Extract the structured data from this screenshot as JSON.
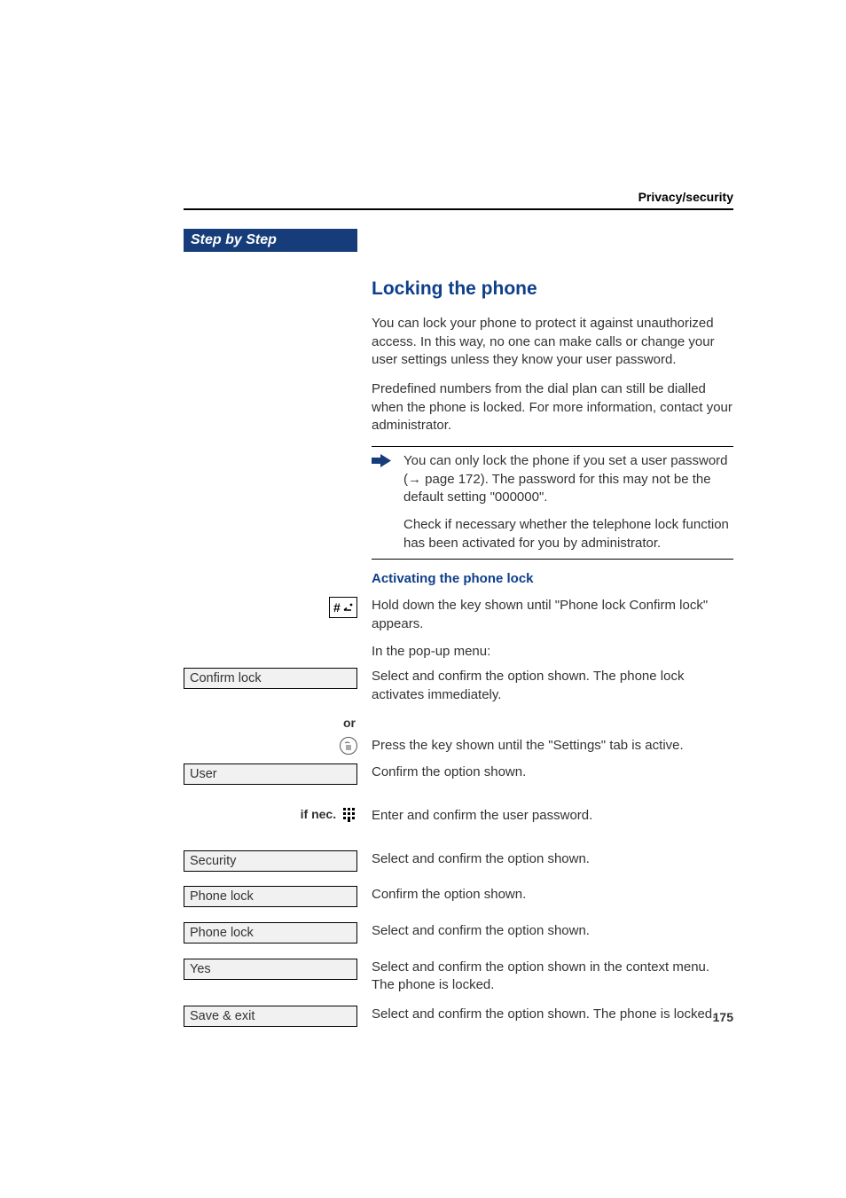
{
  "header": {
    "section": "Privacy/security"
  },
  "sidebar": {
    "step_header": "Step by Step",
    "confirm_lock": "Confirm lock",
    "or": "or",
    "user": "User",
    "if_nec": "if nec.",
    "security": "Security",
    "phone_lock_1": "Phone lock",
    "phone_lock_2": "Phone lock",
    "yes": "Yes",
    "save_exit": "Save & exit"
  },
  "main": {
    "h1": "Locking the phone",
    "p1": "You can lock your phone to protect it against unauthorized access. In this way, no one can make calls or change your user settings unless they know your user password.",
    "p2": "Predefined numbers from the dial plan can still be dialled when the phone is locked. For more information, contact your administrator.",
    "note1": "You can only lock the phone if you set a user password (→ page 172). The password for this may not be the default setting \"000000\".",
    "note2": "Check if necessary whether the telephone lock function has been activated for you by administrator.",
    "sub_h": "Activating the phone lock",
    "hash_text": "Hold down the key shown until \"Phone lock Confirm lock\" appears.",
    "popup": "In the pop-up menu:",
    "confirm_lock_desc": "Select and confirm the option shown. The phone lock activates immediately.",
    "settings_key_desc": "Press the key shown until the \"Settings\" tab is active.",
    "user_desc": "Confirm the option shown.",
    "if_nec_desc": "Enter and confirm the user password.",
    "security_desc": "Select and confirm the option shown.",
    "phone_lock1_desc": "Confirm the option shown.",
    "phone_lock2_desc": "Select and confirm the option shown.",
    "yes_desc": "Select and confirm the option shown in the context menu. The phone is locked.",
    "save_exit_desc": "Select and confirm the option shown. The phone is locked."
  },
  "page_number": "175"
}
